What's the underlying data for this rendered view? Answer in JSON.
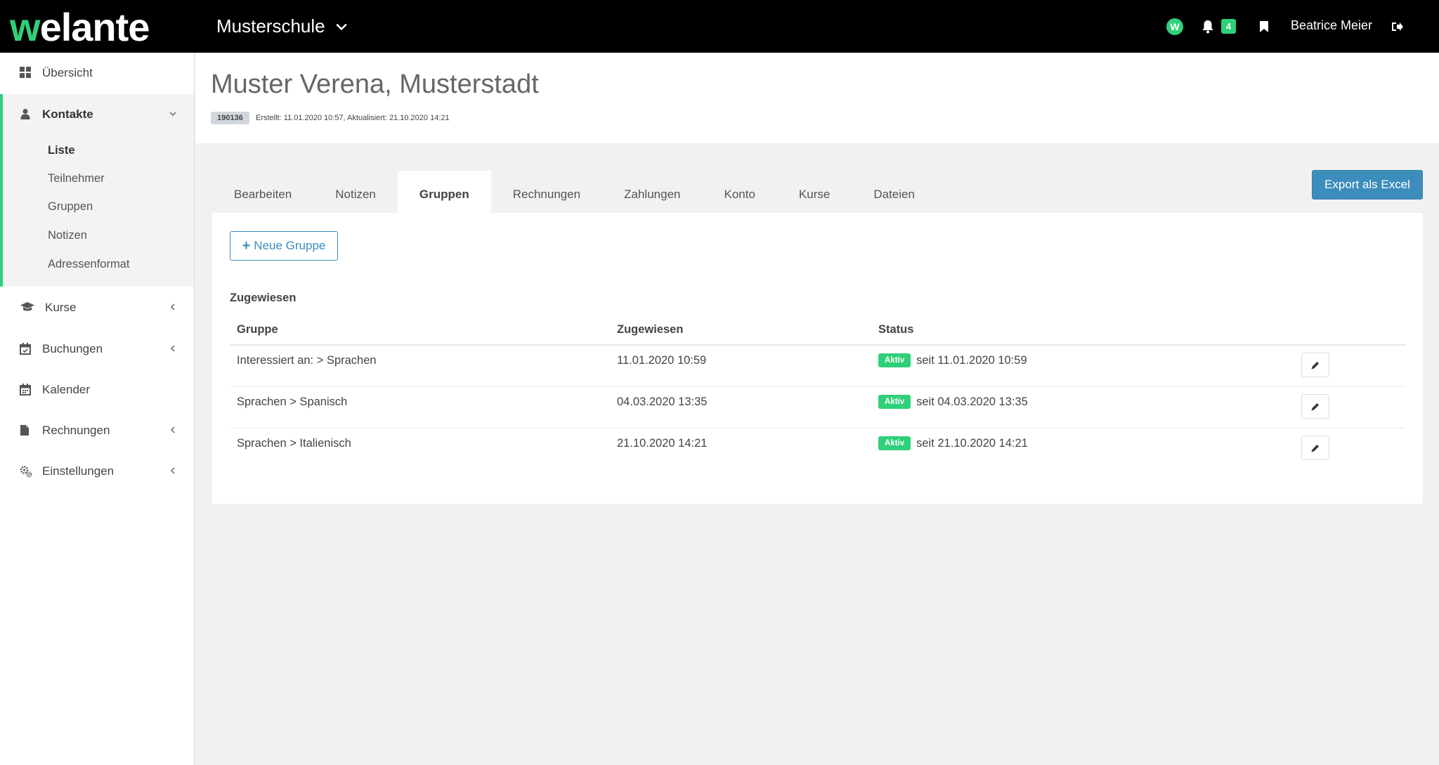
{
  "app": {
    "logo_w": "w",
    "logo_rest": "elante",
    "school": "Musterschule",
    "notification_count": "4",
    "user": "Beatrice Meier",
    "w_icon_letter": "W"
  },
  "sidebar": {
    "items": [
      {
        "label": "Übersicht",
        "icon": "grid-icon"
      },
      {
        "label": "Kontakte",
        "icon": "user-icon"
      },
      {
        "label": "Kurse",
        "icon": "graduation-cap-icon"
      },
      {
        "label": "Buchungen",
        "icon": "calendar-check-icon"
      },
      {
        "label": "Kalender",
        "icon": "calendar-icon"
      },
      {
        "label": "Rechnungen",
        "icon": "file-icon"
      },
      {
        "label": "Einstellungen",
        "icon": "cogs-icon"
      }
    ],
    "sub_items": [
      {
        "label": "Liste",
        "active": true
      },
      {
        "label": "Teilnehmer"
      },
      {
        "label": "Gruppen"
      },
      {
        "label": "Notizen"
      },
      {
        "label": "Adressenformat"
      }
    ]
  },
  "header": {
    "title": "Muster Verena, Musterstadt",
    "id": "190136",
    "meta": "Erstellt: 11.01.2020 10:57, Aktualisiert: 21.10.2020 14:21"
  },
  "tabs": [
    {
      "label": "Bearbeiten"
    },
    {
      "label": "Notizen"
    },
    {
      "label": "Gruppen",
      "active": true
    },
    {
      "label": "Rechnungen"
    },
    {
      "label": "Zahlungen"
    },
    {
      "label": "Konto"
    },
    {
      "label": "Kurse"
    },
    {
      "label": "Dateien"
    }
  ],
  "export_label": "Export als Excel",
  "panel": {
    "new_group_label": "Neue Gruppe",
    "section_title": "Zugewiesen",
    "columns": [
      "Gruppe",
      "Zugewiesen",
      "Status"
    ],
    "rows": [
      {
        "group": "Interessiert an: > Sprachen",
        "assigned": "11.01.2020 10:59",
        "status": "Aktiv",
        "since": "seit 11.01.2020 10:59"
      },
      {
        "group": "Sprachen > Spanisch",
        "assigned": "04.03.2020 13:35",
        "status": "Aktiv",
        "since": "seit 04.03.2020 13:35"
      },
      {
        "group": "Sprachen > Italienisch",
        "assigned": "21.10.2020 14:21",
        "status": "Aktiv",
        "since": "seit 21.10.2020 14:21"
      }
    ]
  },
  "colors": {
    "accent_green": "#2fd07a",
    "primary_blue": "#3c8dbc",
    "topbar": "#000000"
  }
}
